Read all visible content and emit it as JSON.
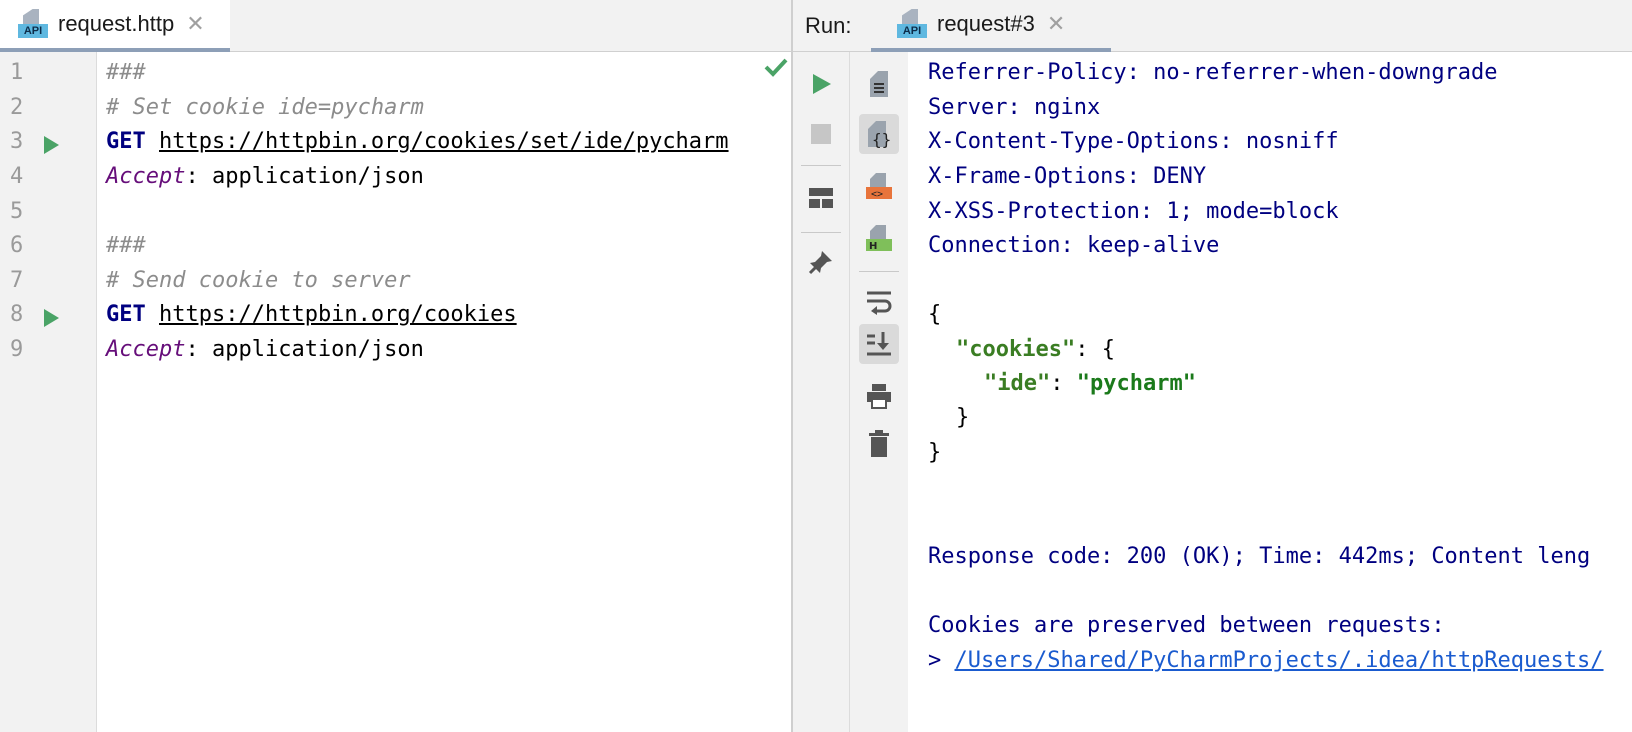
{
  "editor": {
    "tab": {
      "label": "request.http",
      "icon": "api-file-icon",
      "badge": "API"
    },
    "line_numbers": [
      "1",
      "2",
      "3",
      "4",
      "5",
      "6",
      "7",
      "8",
      "9"
    ],
    "lines": {
      "l1": "###",
      "l2": "# Set cookie ide=pycharm",
      "l3_method": "GET",
      "l3_url": "https://httpbin.org/cookies/set/ide/pycharm",
      "l4_header": "Accept",
      "l4_value": ": application/json",
      "l6": "###",
      "l7": "# Send cookie to server",
      "l8_method": "GET",
      "l8_url": "https://httpbin.org/cookies",
      "l9_header": "Accept",
      "l9_value": ": application/json"
    },
    "run_gutter_lines": [
      3,
      8
    ]
  },
  "run_panel": {
    "label": "Run:",
    "tab": {
      "label": "request#3",
      "icon": "api-file-icon",
      "badge": "API"
    },
    "toolbar_left": [
      "run-icon",
      "stop-icon",
      "layout-icon",
      "pin-icon"
    ],
    "toolbar_right": [
      "text-view-icon",
      "json-view-icon",
      "html-view-icon",
      "http-view-icon",
      "soft-wrap-icon",
      "scroll-to-end-icon",
      "print-icon",
      "trash-icon"
    ]
  },
  "output": {
    "headers": [
      "Referrer-Policy: no-referrer-when-downgrade",
      "Server: nginx",
      "X-Content-Type-Options: nosniff",
      "X-Frame-Options: DENY",
      "X-XSS-Protection: 1; mode=block",
      "Connection: keep-alive"
    ],
    "json": {
      "open": "{",
      "cookies_key": "\"cookies\"",
      "cookies_sep": ": {",
      "ide_key": "\"ide\"",
      "ide_sep": ": ",
      "ide_value": "\"pycharm\"",
      "inner_close": "}",
      "outer_close": "}"
    },
    "response_summary": "Response code: 200 (OK); Time: 442ms; Content leng",
    "cookies_note": "Cookies are preserved between requests:",
    "cookies_prefix": "> ",
    "cookies_path": "/Users/Shared/PyCharmProjects/.idea/httpRequests/"
  },
  "colors": {
    "run_green": "#4aa366",
    "header_text": "#000080",
    "json_key": "#3a7d23",
    "link": "#1a5bcf"
  }
}
